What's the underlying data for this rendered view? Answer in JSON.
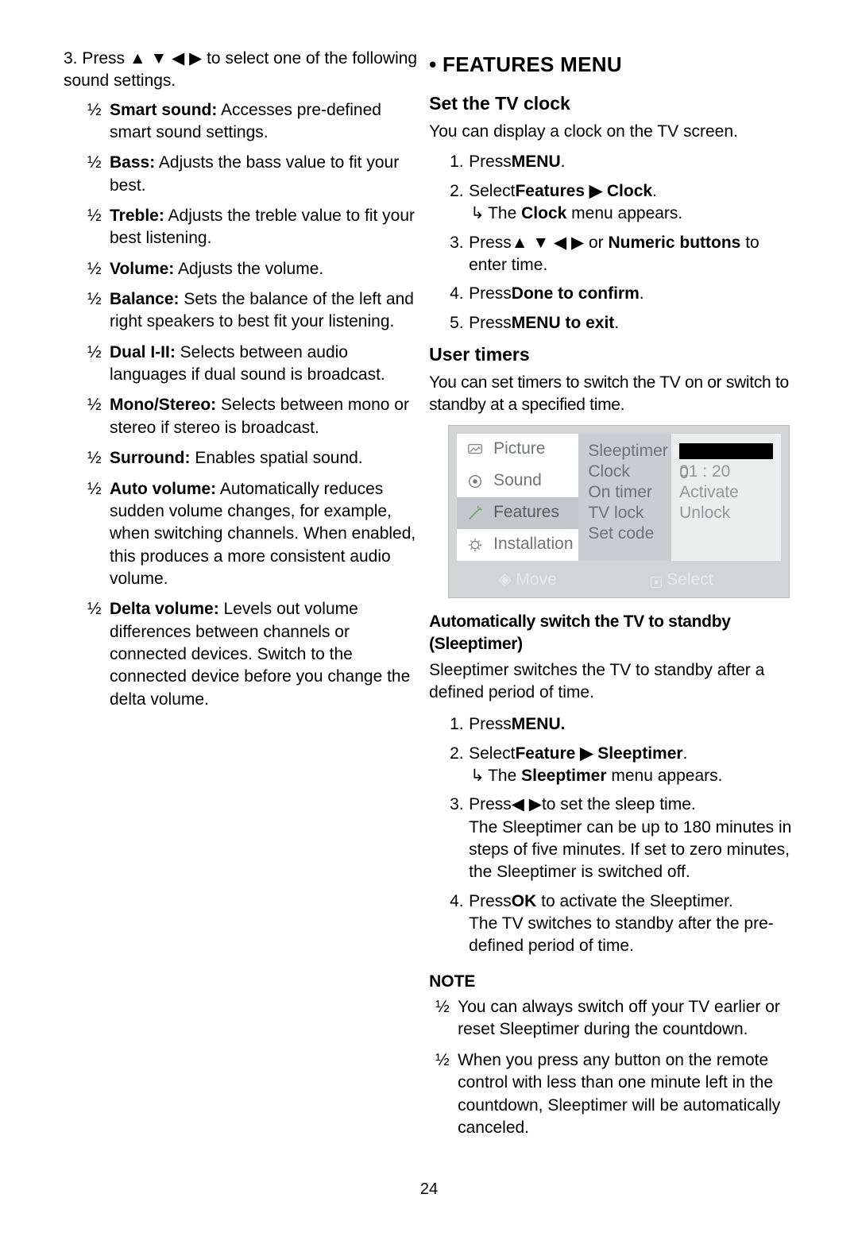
{
  "left": {
    "step3_prefix": "3. Press",
    "arrows": "▲ ▼ ◀ ▶",
    "step3_suffix": " to select one of the following sound settings.",
    "items": [
      {
        "name": "Smart sound:",
        "desc": " Accesses pre-defined smart sound settings."
      },
      {
        "name": "Bass:",
        "desc": " Adjusts the bass value to fit your best."
      },
      {
        "name": "Treble:",
        "desc": " Adjusts the treble value to fit your best listening."
      },
      {
        "name": "Volume:",
        "desc": " Adjusts the volume."
      },
      {
        "name": "Balance:",
        "desc": " Sets the balance of the left and right speakers to best fit your listening."
      },
      {
        "name": "Dual I-II:",
        "desc": " Selects between audio languages if dual sound is broadcast."
      },
      {
        "name": "Mono/Stereo:",
        "desc": " Selects between mono or stereo if stereo is broadcast."
      },
      {
        "name": "Surround:",
        "desc": " Enables spatial sound."
      },
      {
        "name": "Auto volume:",
        "desc": " Automatically reduces sudden volume changes, for example, when switching channels. When enabled, this produces a more consistent audio volume."
      },
      {
        "name": "Delta volume:",
        "desc": " Levels out volume differences between channels or connected devices. Switch to the connected device before you change the delta volume."
      }
    ]
  },
  "right": {
    "features_menu": "FEATURES MENU",
    "set_clock": {
      "heading": "Set the TV clock",
      "intro": "You can display a clock on the TV screen.",
      "s1_pre": "Press",
      "s1_btn": "MENU",
      "s1_post": ".",
      "s2_pre": "Select",
      "s2_path1": "Features",
      "s2_arrow": "▶",
      "s2_path2": "Clock",
      "s2_post": ".",
      "s2_result_pre": "The ",
      "s2_result_b": "Clock",
      "s2_result_post": " menu appears.",
      "s3_pre": "Press",
      "s3_arrows": "▲ ▼ ◀ ▶",
      "s3_mid": " or ",
      "s3_b": "Numeric buttons",
      "s3_post": " to enter time.",
      "s4_pre": "Press",
      "s4_b": "Done to confirm",
      "s4_post": ".",
      "s5_pre": "Press",
      "s5_b": "MENU to exit",
      "s5_post": "."
    },
    "user_timers": {
      "heading": "User timers",
      "intro": "You can set timers to switch the TV on or switch to standby at a specified time."
    },
    "menu": {
      "sidebar": [
        "Picture",
        "Sound",
        "Features",
        "Installation"
      ],
      "midcol": [
        "Sleeptimer",
        "Clock",
        "On timer",
        "TV lock",
        "Set code"
      ],
      "valcol_0_suffix": "0",
      "valcol": [
        "",
        "01 : 20",
        "Activate",
        "Unlock",
        ""
      ],
      "footer_move": "Move",
      "footer_select": "Select"
    },
    "sleeptimer": {
      "heading": "Automatically switch the TV to standby (Sleeptimer)",
      "intro": "Sleeptimer switches the TV to standby after a defined period of time.",
      "s1_pre": "Press",
      "s1_b": "MENU.",
      "s2_pre": "Select",
      "s2_path1": "Feature",
      "s2_arrow": "▶",
      "s2_path2": "Sleeptimer",
      "s2_post": ".",
      "s2_result_pre": "The ",
      "s2_result_b": "Sleeptimer",
      "s2_result_post": " menu appears.",
      "s3_pre": "Press",
      "s3_arrows": "◀ ▶",
      "s3_post": "to set the sleep time.\nThe Sleeptimer can be up to 180 minutes in steps of five minutes. If set to zero minutes, the Sleeptimer is switched off.",
      "s4_pre": "Press",
      "s4_b": "OK",
      "s4_post": " to activate the Sleeptimer.\nThe TV switches to standby after the pre-defined period of time."
    },
    "note": {
      "heading": "NOTE",
      "items": [
        "You can always switch off your TV earlier or reset Sleeptimer during the countdown.",
        "When you press any button on the remote control with less than one minute left in the countdown, Sleeptimer will be automatically canceled."
      ]
    }
  },
  "pagenum": "24"
}
